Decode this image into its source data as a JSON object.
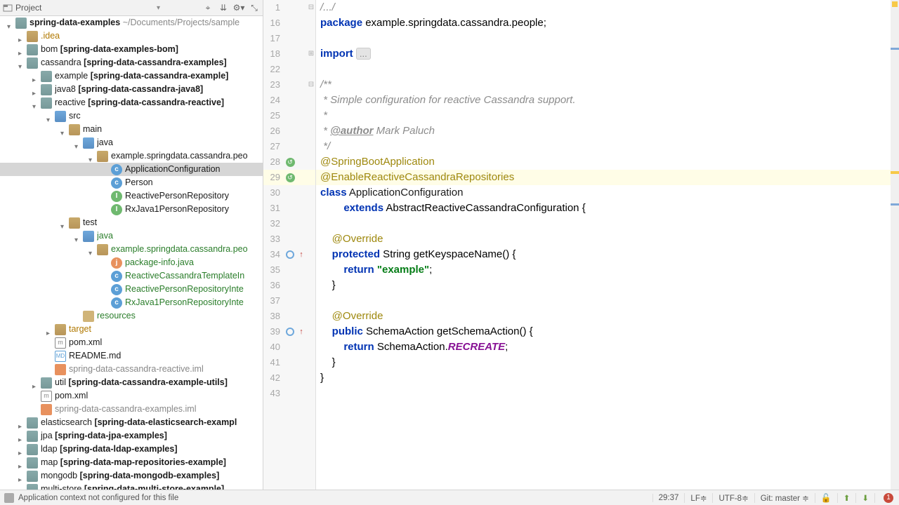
{
  "projectHeader": {
    "title": "Project"
  },
  "tree": [
    {
      "ind": 10,
      "tw": "open",
      "ico": "mod",
      "html": "<span class='bold'>spring-data-examples</span> <span class='mod'>~/Documents/Projects/sample</span>"
    },
    {
      "ind": 26,
      "tw": "closed",
      "ico": "folder",
      "html": "<span class='exc'>.idea</span>"
    },
    {
      "ind": 26,
      "tw": "closed",
      "ico": "mod",
      "html": "bom <span class='bold'>[spring-data-examples-bom]</span>"
    },
    {
      "ind": 26,
      "tw": "open",
      "ico": "mod",
      "html": "cassandra <span class='bold'>[spring-data-cassandra-examples]</span>"
    },
    {
      "ind": 46,
      "tw": "closed",
      "ico": "mod",
      "html": "example <span class='bold'>[spring-data-cassandra-example]</span>"
    },
    {
      "ind": 46,
      "tw": "closed",
      "ico": "mod",
      "html": "java8 <span class='bold'>[spring-data-cassandra-java8]</span>"
    },
    {
      "ind": 46,
      "tw": "open",
      "ico": "mod",
      "html": "reactive <span class='bold'>[spring-data-cassandra-reactive]</span>"
    },
    {
      "ind": 66,
      "tw": "open",
      "ico": "folder-blue",
      "html": "src"
    },
    {
      "ind": 86,
      "tw": "open",
      "ico": "folder",
      "html": "main"
    },
    {
      "ind": 106,
      "tw": "open",
      "ico": "folder-blue",
      "html": "java"
    },
    {
      "ind": 126,
      "tw": "open",
      "ico": "folder",
      "html": "example.springdata.cassandra.peo"
    },
    {
      "ind": 146,
      "tw": "",
      "ico": "file-c",
      "icoText": "c",
      "html": "ApplicationConfiguration",
      "sel": true
    },
    {
      "ind": 146,
      "tw": "",
      "ico": "file-c",
      "icoText": "c",
      "html": "Person"
    },
    {
      "ind": 146,
      "tw": "",
      "ico": "file-i",
      "icoText": "I",
      "html": "ReactivePersonRepository"
    },
    {
      "ind": 146,
      "tw": "",
      "ico": "file-i",
      "icoText": "I",
      "html": "RxJava1PersonRepository"
    },
    {
      "ind": 86,
      "tw": "open",
      "ico": "folder",
      "html": "test"
    },
    {
      "ind": 106,
      "tw": "open",
      "ico": "folder-blue",
      "html": "java",
      "new": true
    },
    {
      "ind": 126,
      "tw": "open",
      "ico": "folder",
      "html": "example.springdata.cassandra.peo",
      "new": true
    },
    {
      "ind": 146,
      "tw": "",
      "ico": "file-j",
      "icoText": "j",
      "html": "package-info.java",
      "new": true
    },
    {
      "ind": 146,
      "tw": "",
      "ico": "file-c",
      "icoText": "c",
      "html": "ReactiveCassandraTemplateIn",
      "new": true
    },
    {
      "ind": 146,
      "tw": "",
      "ico": "file-c",
      "icoText": "c",
      "html": "ReactivePersonRepositoryInte",
      "new": true
    },
    {
      "ind": 146,
      "tw": "",
      "ico": "file-c",
      "icoText": "c",
      "html": "RxJava1PersonRepositoryInte",
      "new": true
    },
    {
      "ind": 106,
      "tw": "",
      "ico": "folder-closed",
      "html": "resources",
      "new": true
    },
    {
      "ind": 66,
      "tw": "closed",
      "ico": "folder",
      "html": "<span class='exc'>target</span>"
    },
    {
      "ind": 66,
      "tw": "",
      "ico": "file-m",
      "icoText": "m",
      "html": "pom.xml"
    },
    {
      "ind": 66,
      "tw": "",
      "ico": "file-md",
      "icoText": "MD",
      "html": "README.md"
    },
    {
      "ind": 66,
      "tw": "",
      "ico": "file-y",
      "html": "<span class='mod'>spring-data-cassandra-reactive.iml</span>"
    },
    {
      "ind": 46,
      "tw": "closed",
      "ico": "mod",
      "html": "util <span class='bold'>[spring-data-cassandra-example-utils]</span>"
    },
    {
      "ind": 46,
      "tw": "",
      "ico": "file-m",
      "icoText": "m",
      "html": "pom.xml"
    },
    {
      "ind": 46,
      "tw": "",
      "ico": "file-y",
      "html": "<span class='mod'>spring-data-cassandra-examples.iml</span>"
    },
    {
      "ind": 26,
      "tw": "closed",
      "ico": "mod",
      "html": "elasticsearch <span class='bold'>[spring-data-elasticsearch-exampl</span>"
    },
    {
      "ind": 26,
      "tw": "closed",
      "ico": "mod",
      "html": "jpa <span class='bold'>[spring-data-jpa-examples]</span>"
    },
    {
      "ind": 26,
      "tw": "closed",
      "ico": "mod",
      "html": "ldap <span class='bold'>[spring-data-ldap-examples]</span>"
    },
    {
      "ind": 26,
      "tw": "closed",
      "ico": "mod",
      "html": "map <span class='bold'>[spring-data-map-repositories-example]</span>"
    },
    {
      "ind": 26,
      "tw": "closed",
      "ico": "mod",
      "html": "mongodb <span class='bold'>[spring-data-mongodb-examples]</span>"
    },
    {
      "ind": 26,
      "tw": "closed",
      "ico": "mod",
      "html": "multi-store <span class='bold'>[spring-data-multi-store-example]</span>"
    }
  ],
  "editor": {
    "lines": [
      {
        "n": 1,
        "fold": "⊟",
        "html": "<span class='cmt'>/.../</span>"
      },
      {
        "n": 16,
        "html": "<span class='kw'>package</span> example.springdata.cassandra.people;"
      },
      {
        "n": 17,
        "html": ""
      },
      {
        "n": 18,
        "fold": "⊞",
        "html": "<span class='kw'>import</span> <span class='fold-dots'>...</span>"
      },
      {
        "n": 22,
        "html": ""
      },
      {
        "n": 23,
        "fold": "⊟",
        "html": "<span class='cmt'>/**</span>"
      },
      {
        "n": 24,
        "html": "<span class='cmt'> * Simple configuration for reactive Cassandra support.</span>"
      },
      {
        "n": 25,
        "html": "<span class='cmt'> *</span>"
      },
      {
        "n": 26,
        "html": "<span class='cmt'> * </span><span class='cmt-tag'>@author</span><span class='cmt'> Mark Paluch</span>"
      },
      {
        "n": 27,
        "html": "<span class='cmt'> */</span>"
      },
      {
        "n": 28,
        "mark": "green",
        "html": "<span class='ann'>@SpringBootApplication</span>"
      },
      {
        "n": 29,
        "mark": "green",
        "cur": true,
        "html": "<span class='ann'>@EnableReactiveCassandraRepositories</span>"
      },
      {
        "n": 30,
        "html": "<span class='kw'>class</span> <span class='id-hl'>ApplicationConfiguration</span>"
      },
      {
        "n": 31,
        "html": "        <span class='kw'>extends</span> AbstractReactiveCassandraConfiguration {"
      },
      {
        "n": 32,
        "html": ""
      },
      {
        "n": 33,
        "html": "    <span class='ann'>@Override</span>"
      },
      {
        "n": 34,
        "mark": "ov",
        "impl": true,
        "html": "    <span class='kw'>protected</span> String getKeyspaceName() {"
      },
      {
        "n": 35,
        "html": "        <span class='kw'>return</span> <span class='str'>\"example\"</span>;"
      },
      {
        "n": 36,
        "html": "    }"
      },
      {
        "n": 37,
        "html": ""
      },
      {
        "n": 38,
        "html": "    <span class='ann'>@Override</span>"
      },
      {
        "n": 39,
        "mark": "ov",
        "impl": true,
        "html": "    <span class='kw'>public</span> SchemaAction getSchemaAction() {"
      },
      {
        "n": 40,
        "html": "        <span class='kw'>return</span> SchemaAction.<span class='const'>RECREATE</span>;"
      },
      {
        "n": 41,
        "html": "    }"
      },
      {
        "n": 42,
        "html": "}"
      },
      {
        "n": 43,
        "html": ""
      }
    ]
  },
  "status": {
    "msg": "Application context not configured for this file",
    "pos": "29:37",
    "lf": "LF≑",
    "enc": "UTF-8≑",
    "git": "Git: master ≑",
    "badge": "1"
  }
}
